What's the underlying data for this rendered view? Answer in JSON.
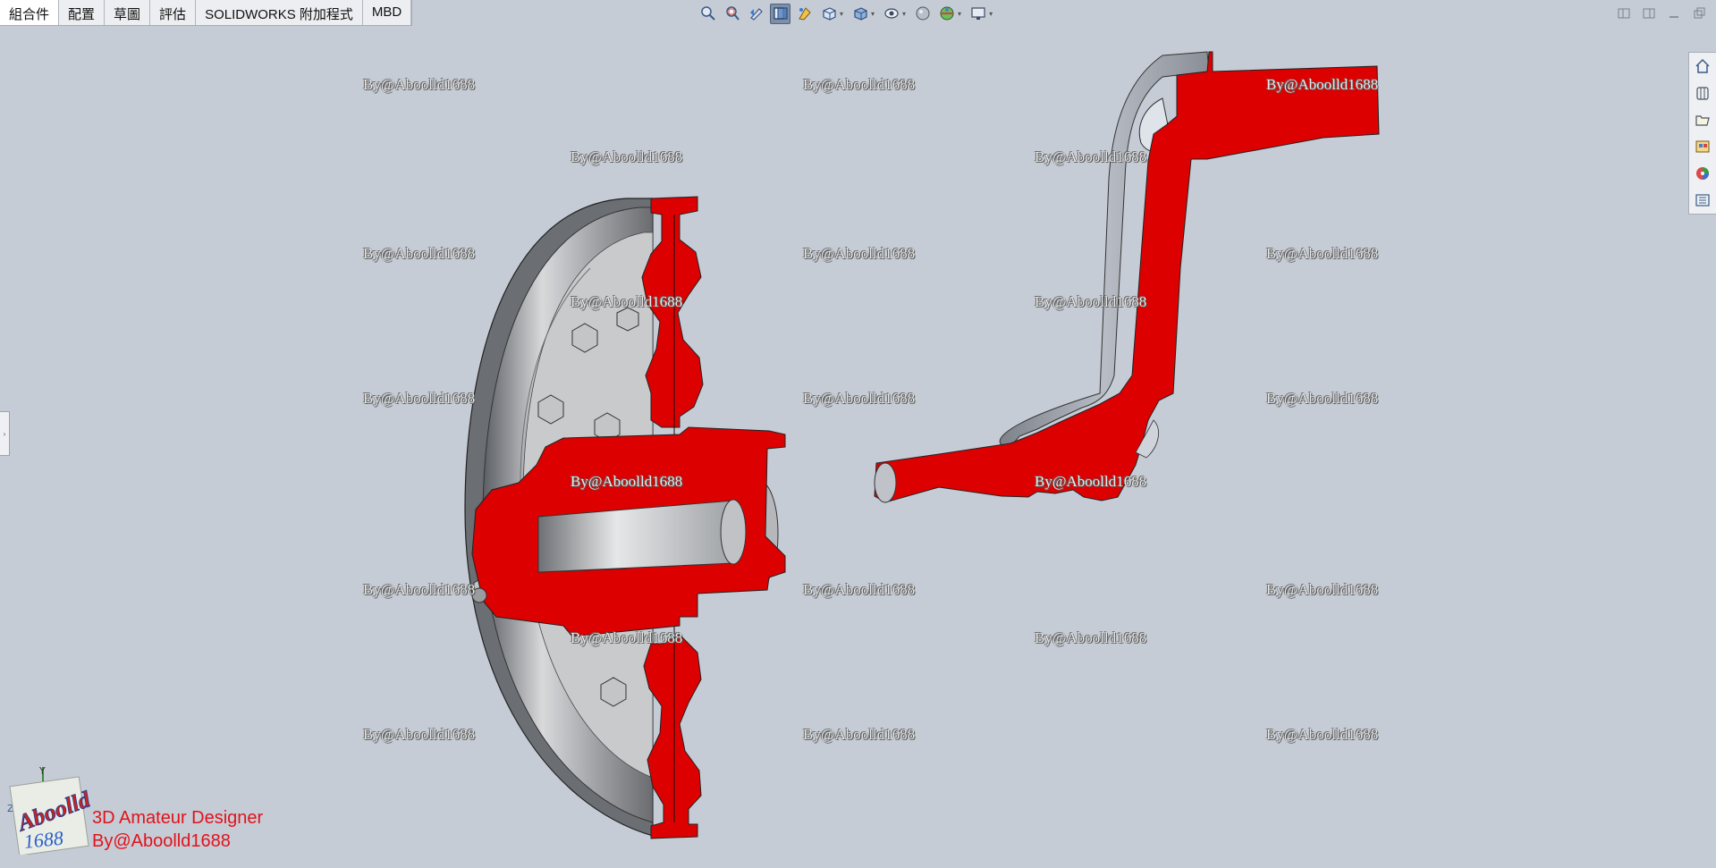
{
  "command_manager": {
    "tabs": [
      {
        "label": "組合件",
        "active": true
      },
      {
        "label": "配置"
      },
      {
        "label": "草圖"
      },
      {
        "label": "評估"
      },
      {
        "label": "SOLIDWORKS 附加程式"
      },
      {
        "label": "MBD"
      }
    ]
  },
  "heads_up_toolbar": {
    "buttons": [
      "zoom-to-fit-icon",
      "zoom-to-area-icon",
      "previous-view-icon",
      "section-view-icon",
      "dynamic-annotation-icon",
      "view-orientation-icon",
      "display-style-icon",
      "hide-show-items-icon",
      "edit-appearance-icon",
      "apply-scene-icon",
      "view-settings-icon"
    ]
  },
  "task_pane": {
    "buttons": [
      "home-icon",
      "design-library-icon",
      "file-explorer-icon",
      "view-palette-icon",
      "appearances-icon",
      "custom-properties-icon"
    ]
  },
  "watermark_text": "By@Aboolld1688",
  "brand": {
    "line1": "3D Amateur Designer",
    "line2": "By@Aboolld1688",
    "logo_text_top": "Aboolld",
    "logo_text_bottom": "1688",
    "axis_y": "Y",
    "axis_z": "Z"
  },
  "colors": {
    "viewport_bg": "#c6ccd6",
    "section_cut": "#dd0000",
    "brand_text": "#e0131a"
  }
}
